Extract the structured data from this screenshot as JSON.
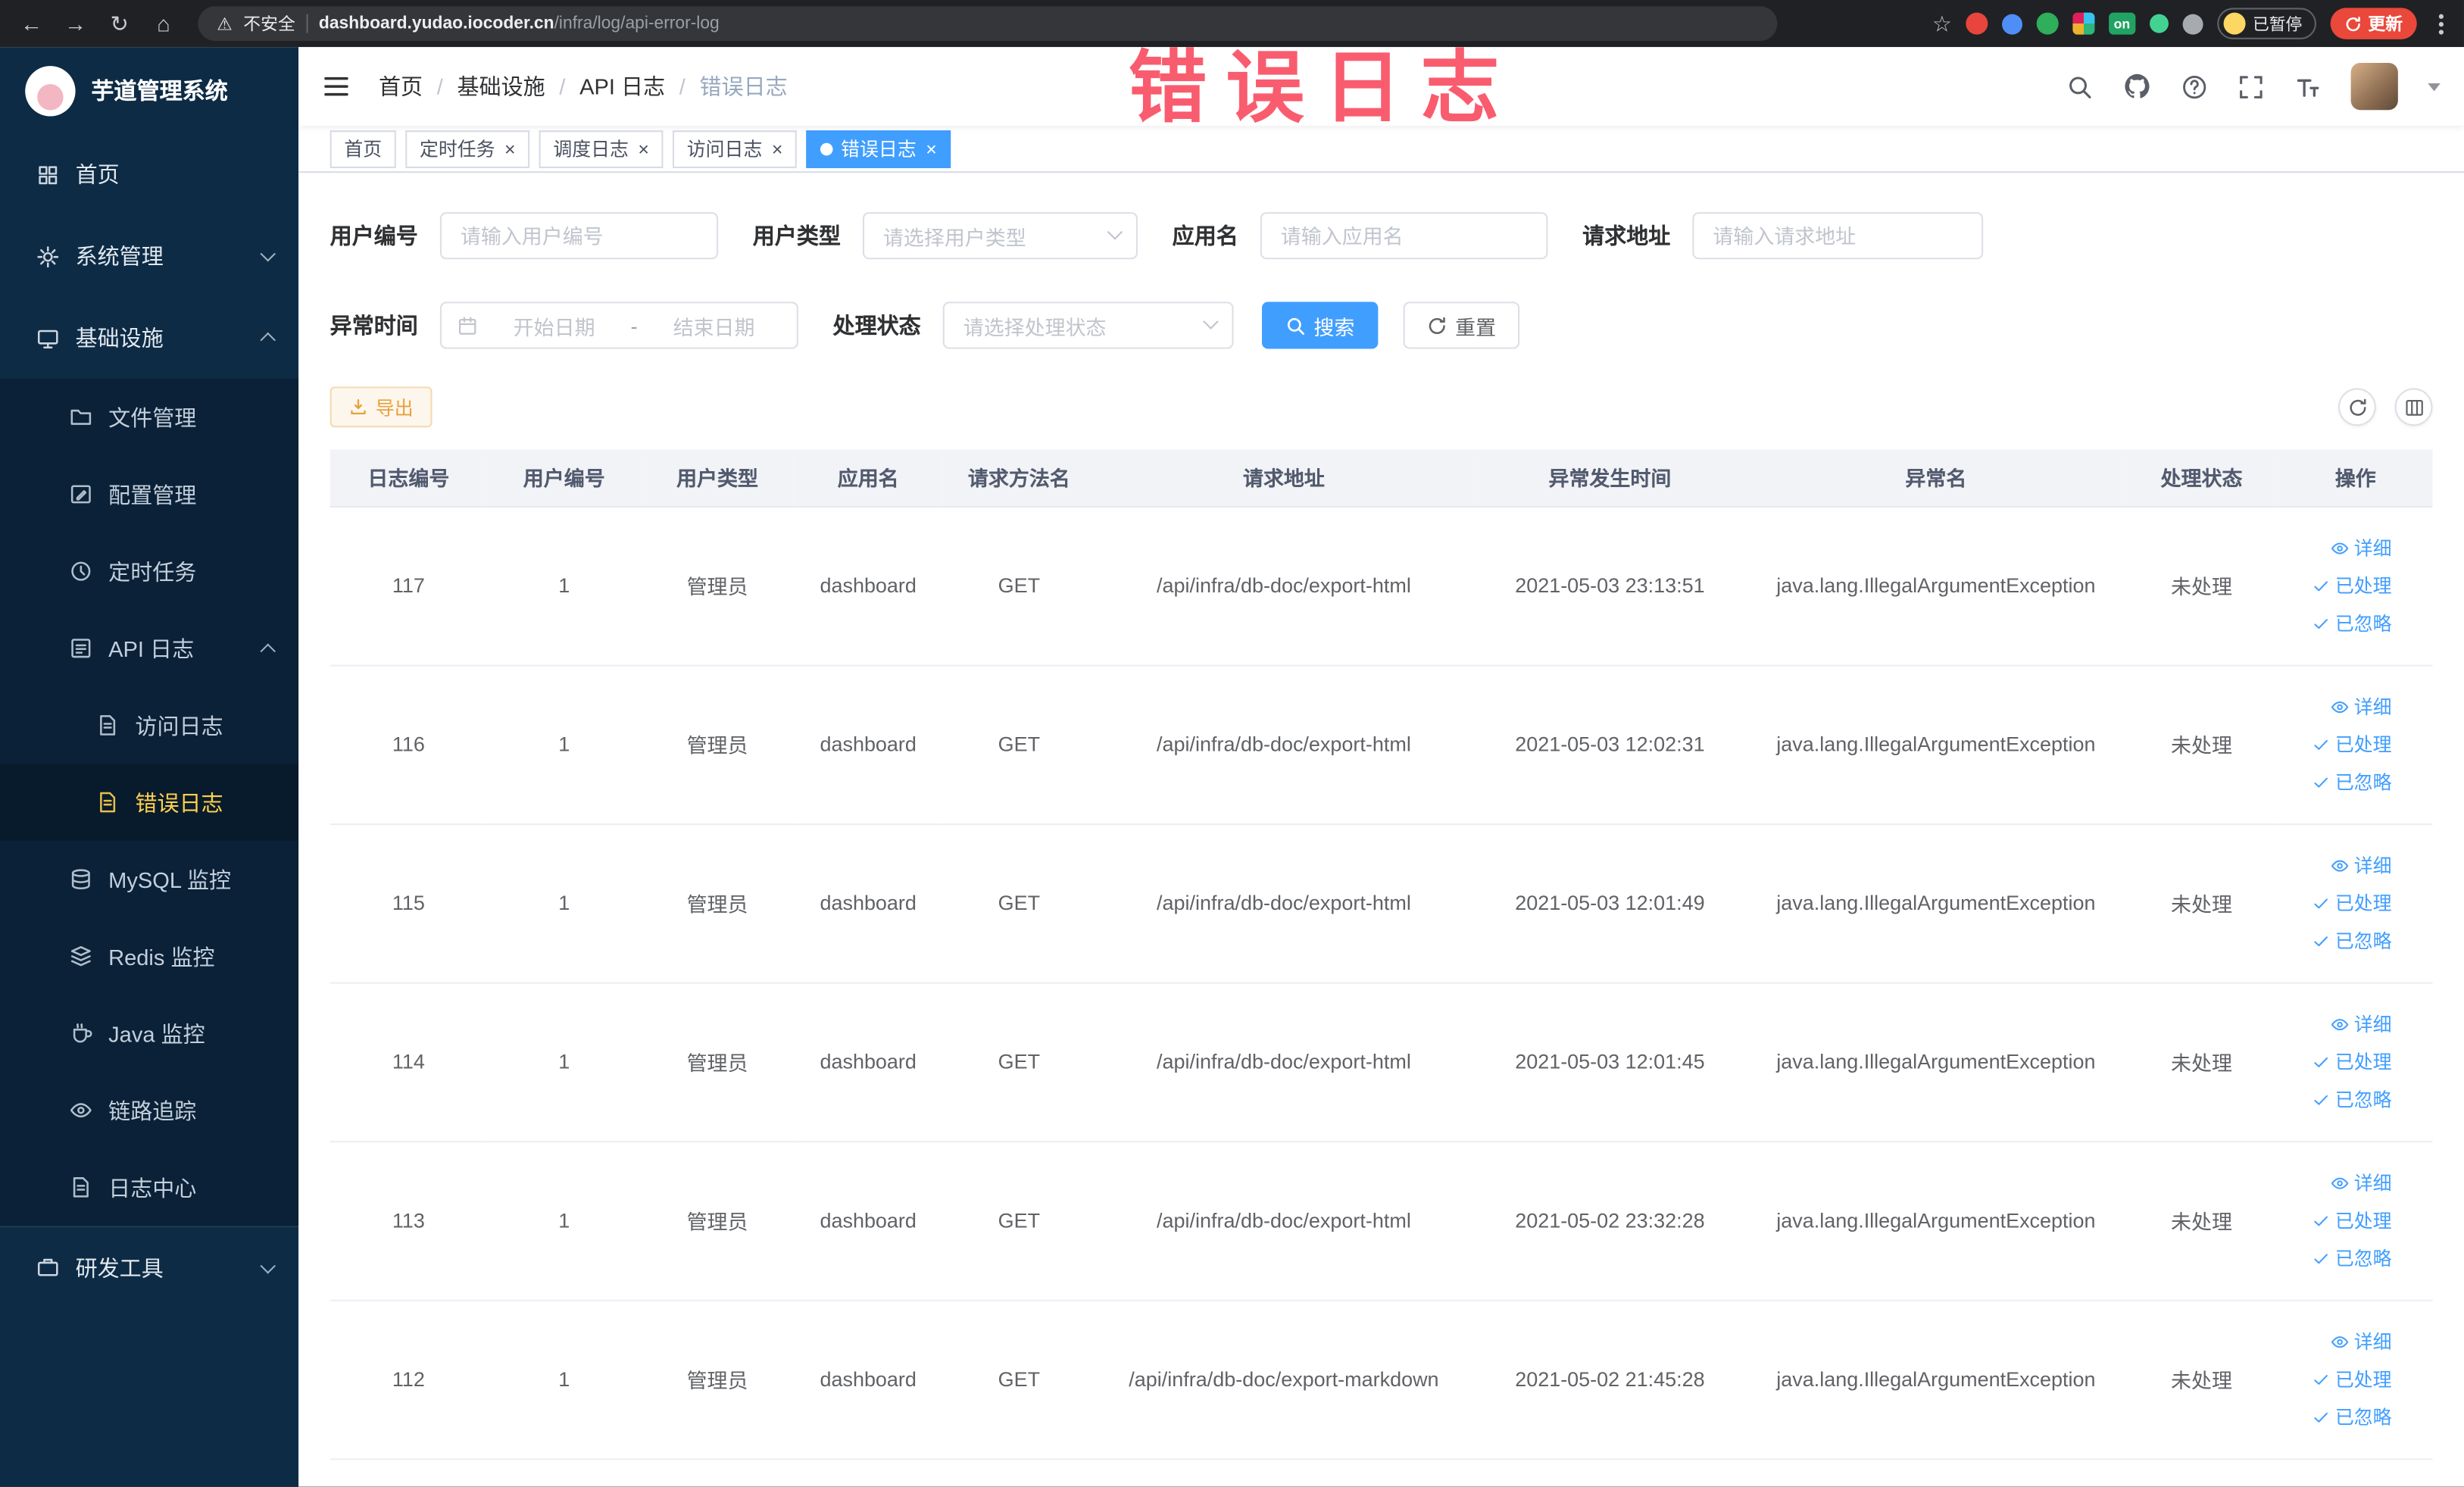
{
  "browser": {
    "security_label": "不安全",
    "url_domain": "dashboard.yudao.iocoder.cn",
    "url_path": "/infra/log/api-error-log",
    "extension_on_label": "on",
    "paused_label": "已暂停",
    "update_label": "更新"
  },
  "watermark": "错误日志",
  "sidebar": {
    "title": "芋道管理系统",
    "items": [
      {
        "name": "home",
        "label": "首页",
        "icon": "dashboard-icon",
        "level": 1
      },
      {
        "name": "system",
        "label": "系统管理",
        "icon": "gear-icon",
        "level": 1,
        "arrow": "down"
      },
      {
        "name": "infra",
        "label": "基础设施",
        "icon": "monitor-icon",
        "level": 1,
        "arrow": "up"
      },
      {
        "name": "file",
        "label": "文件管理",
        "icon": "folder-icon",
        "level": 2
      },
      {
        "name": "config",
        "label": "配置管理",
        "icon": "edit-icon",
        "level": 2
      },
      {
        "name": "job",
        "label": "定时任务",
        "icon": "clock-icon",
        "level": 2
      },
      {
        "name": "api-log",
        "label": "API 日志",
        "icon": "log-icon",
        "level": 2,
        "arrow": "up"
      },
      {
        "name": "access-log",
        "label": "访问日志",
        "icon": "doc-icon",
        "level": 3
      },
      {
        "name": "error-log",
        "label": "错误日志",
        "icon": "doc-icon",
        "level": 3,
        "active": true
      },
      {
        "name": "mysql",
        "label": "MySQL 监控",
        "icon": "database-icon",
        "level": 2
      },
      {
        "name": "redis",
        "label": "Redis 监控",
        "icon": "layers-icon",
        "level": 2
      },
      {
        "name": "java",
        "label": "Java 监控",
        "icon": "cup-icon",
        "level": 2
      },
      {
        "name": "trace",
        "label": "链路追踪",
        "icon": "eye-icon",
        "level": 2
      },
      {
        "name": "log-center",
        "label": "日志中心",
        "icon": "doc-icon",
        "level": 2
      },
      {
        "name": "devtools",
        "label": "研发工具",
        "icon": "briefcase-icon",
        "level": 1,
        "arrow": "down",
        "divider": true
      }
    ]
  },
  "breadcrumb": {
    "separator": "/",
    "items": [
      "首页",
      "基础设施",
      "API 日志",
      "错误日志"
    ]
  },
  "tabs": {
    "close_glyph": "×",
    "items": [
      {
        "label": "首页",
        "closable": false,
        "active": false
      },
      {
        "label": "定时任务",
        "closable": true,
        "active": false
      },
      {
        "label": "调度日志",
        "closable": true,
        "active": false
      },
      {
        "label": "访问日志",
        "closable": true,
        "active": false
      },
      {
        "label": "错误日志",
        "closable": true,
        "active": true
      }
    ]
  },
  "filters": {
    "user_id_label": "用户编号",
    "user_id_placeholder": "请输入用户编号",
    "user_type_label": "用户类型",
    "user_type_placeholder": "请选择用户类型",
    "app_name_label": "应用名",
    "app_name_placeholder": "请输入应用名",
    "request_url_label": "请求地址",
    "request_url_placeholder": "请输入请求地址",
    "time_label": "异常时间",
    "time_start_placeholder": "开始日期",
    "time_separator": "-",
    "time_end_placeholder": "结束日期",
    "status_label": "处理状态",
    "status_placeholder": "请选择处理状态",
    "search_label": "搜索",
    "reset_label": "重置"
  },
  "toolbar": {
    "export_label": "导出"
  },
  "table": {
    "columns": [
      "日志编号",
      "用户编号",
      "用户类型",
      "应用名",
      "请求方法名",
      "请求地址",
      "异常发生时间",
      "异常名",
      "处理状态",
      "操作"
    ],
    "row_keys": [
      "id",
      "user_id",
      "user_type",
      "app",
      "method",
      "url",
      "time",
      "exception",
      "status"
    ],
    "actions": [
      "详细",
      "已处理",
      "已忽略"
    ],
    "rows": [
      {
        "id": "117",
        "user_id": "1",
        "user_type": "管理员",
        "app": "dashboard",
        "method": "GET",
        "url": "/api/infra/db-doc/export-html",
        "time": "2021-05-03 23:13:51",
        "exception": "java.lang.IllegalArgumentException",
        "status": "未处理"
      },
      {
        "id": "116",
        "user_id": "1",
        "user_type": "管理员",
        "app": "dashboard",
        "method": "GET",
        "url": "/api/infra/db-doc/export-html",
        "time": "2021-05-03 12:02:31",
        "exception": "java.lang.IllegalArgumentException",
        "status": "未处理"
      },
      {
        "id": "115",
        "user_id": "1",
        "user_type": "管理员",
        "app": "dashboard",
        "method": "GET",
        "url": "/api/infra/db-doc/export-html",
        "time": "2021-05-03 12:01:49",
        "exception": "java.lang.IllegalArgumentException",
        "status": "未处理"
      },
      {
        "id": "114",
        "user_id": "1",
        "user_type": "管理员",
        "app": "dashboard",
        "method": "GET",
        "url": "/api/infra/db-doc/export-html",
        "time": "2021-05-03 12:01:45",
        "exception": "java.lang.IllegalArgumentException",
        "status": "未处理"
      },
      {
        "id": "113",
        "user_id": "1",
        "user_type": "管理员",
        "app": "dashboard",
        "method": "GET",
        "url": "/api/infra/db-doc/export-html",
        "time": "2021-05-02 23:32:28",
        "exception": "java.lang.IllegalArgumentException",
        "status": "未处理"
      },
      {
        "id": "112",
        "user_id": "1",
        "user_type": "管理员",
        "app": "dashboard",
        "method": "GET",
        "url": "/api/infra/db-doc/export-markdown",
        "time": "2021-05-02 21:45:28",
        "exception": "java.lang.IllegalArgumentException",
        "status": "未处理"
      }
    ]
  }
}
